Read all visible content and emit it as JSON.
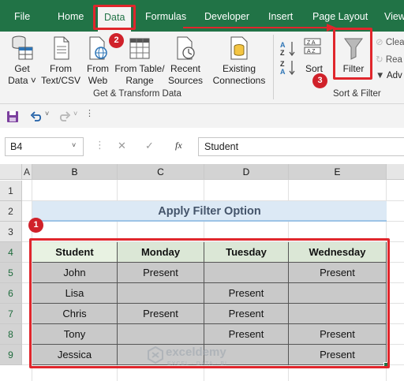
{
  "menu": {
    "items": [
      "File",
      "Home",
      "Data",
      "Formulas",
      "Developer",
      "Insert",
      "Page Layout",
      "View"
    ],
    "active_index": 2
  },
  "ribbon": {
    "get_transform": {
      "buttons": [
        {
          "line1": "Get",
          "line2": "Data ˅",
          "icon": "database-table-icon"
        },
        {
          "line1": "From",
          "line2": "Text/CSV",
          "icon": "text-file-icon"
        },
        {
          "line1": "From",
          "line2": "Web",
          "icon": "web-globe-icon"
        },
        {
          "line1": "From Table/",
          "line2": "Range",
          "icon": "table-range-icon"
        },
        {
          "line1": "Recent",
          "line2": "Sources",
          "icon": "recent-sources-icon"
        },
        {
          "line1": "Existing",
          "line2": "Connections",
          "icon": "existing-connections-icon"
        }
      ],
      "label": "Get & Transform Data"
    },
    "sort_filter": {
      "sort_label": "Sort",
      "filter_label": "Filter",
      "clear_label": "Clea",
      "reapply_label": "Rea",
      "advanced_label": "Adv",
      "label": "Sort & Filter"
    }
  },
  "formula_bar": {
    "name_box": "B4",
    "cancel_symbol": "✕",
    "enter_symbol": "✓",
    "fx_symbol": "fx",
    "formula": "Student"
  },
  "grid": {
    "columns": [
      "A",
      "B",
      "C",
      "D",
      "E"
    ],
    "rows": [
      "1",
      "2",
      "3",
      "4",
      "5",
      "6",
      "7",
      "8",
      "9"
    ],
    "title": "Apply Filter Option",
    "table": {
      "headers": [
        "Student",
        "Monday",
        "Tuesday",
        "Wednesday"
      ],
      "rows": [
        [
          "John",
          "Present",
          "",
          "Present"
        ],
        [
          "Lisa",
          "",
          "Present",
          ""
        ],
        [
          "Chris",
          "Present",
          "Present",
          ""
        ],
        [
          "Tony",
          "",
          "Present",
          "Present"
        ],
        [
          "Jessica",
          "",
          "",
          "Present"
        ]
      ]
    }
  },
  "badges": [
    "1",
    "2",
    "3"
  ],
  "watermark": {
    "name": "exceldemy",
    "tagline": "EXCEL · DATA · BI"
  },
  "colors": {
    "excel_green": "#217346",
    "annotation_red": "#e0262c",
    "badge_red": "#d0212a",
    "title_fill": "#dce9f5"
  }
}
